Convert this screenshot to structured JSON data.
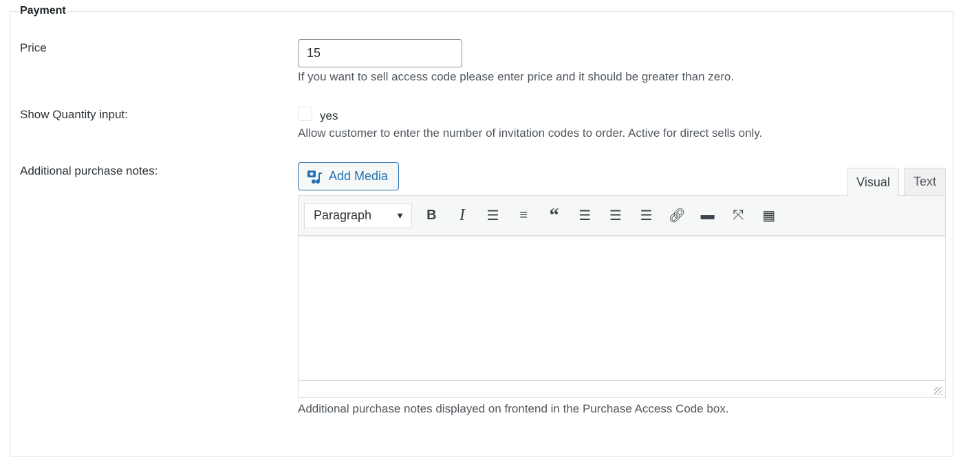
{
  "legend": "Payment",
  "price": {
    "label": "Price",
    "value": "15",
    "description": "If you want to sell access code please enter price and it should be greater than zero."
  },
  "quantity": {
    "label": "Show Quantity input:",
    "checked": false,
    "option": "yes",
    "description": "Allow customer to enter the number of invitation codes to order. Active for direct sells only."
  },
  "notes": {
    "label": "Additional purchase notes:",
    "add_media": "Add Media",
    "tabs": [
      "Visual",
      "Text"
    ],
    "active_tab": "Visual",
    "format": "Paragraph",
    "toolbar": [
      "bold-icon",
      "italic-icon",
      "bulleted-list-icon",
      "numbered-list-icon",
      "blockquote-icon",
      "align-left-icon",
      "align-center-icon",
      "align-right-icon",
      "link-icon",
      "read-more-icon",
      "fullscreen-icon",
      "toolbar-toggle-icon"
    ],
    "content": "",
    "description": "Additional purchase notes displayed on frontend in the Purchase Access Code box."
  },
  "colors": {
    "accent": "#2271b1"
  }
}
